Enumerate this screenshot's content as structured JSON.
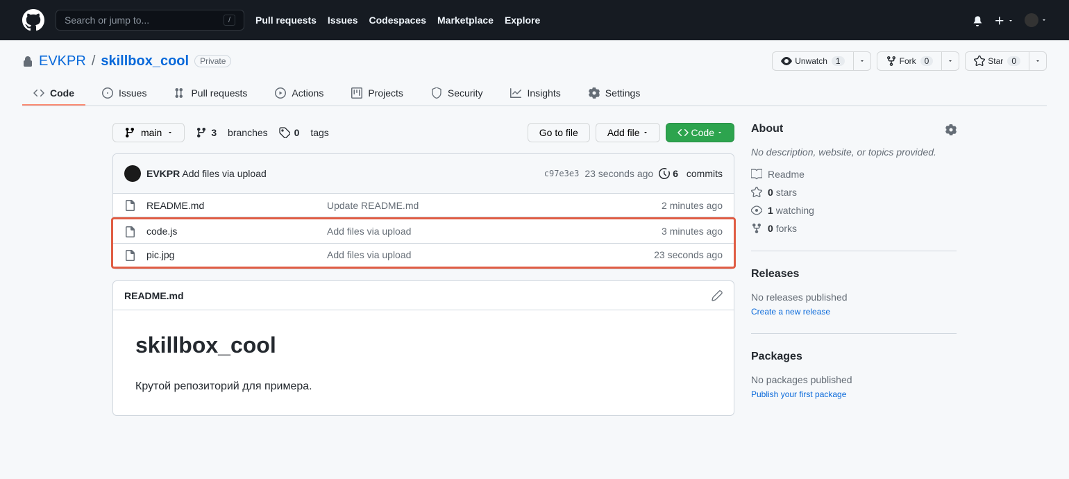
{
  "header": {
    "search_placeholder": "Search or jump to...",
    "nav": [
      "Pull requests",
      "Issues",
      "Codespaces",
      "Marketplace",
      "Explore"
    ]
  },
  "repo": {
    "owner": "EVKPR",
    "name": "skillbox_cool",
    "visibility": "Private",
    "watch": {
      "label": "Unwatch",
      "count": "1"
    },
    "fork": {
      "label": "Fork",
      "count": "0"
    },
    "star": {
      "label": "Star",
      "count": "0"
    }
  },
  "tabs": {
    "code": "Code",
    "issues": "Issues",
    "pulls": "Pull requests",
    "actions": "Actions",
    "projects": "Projects",
    "security": "Security",
    "insights": "Insights",
    "settings": "Settings"
  },
  "filenav": {
    "branch": "main",
    "branches_count": "3",
    "branches_label": "branches",
    "tags_count": "0",
    "tags_label": "tags",
    "goto": "Go to file",
    "addfile": "Add file",
    "code": "Code"
  },
  "latest_commit": {
    "author": "EVKPR",
    "message": "Add files via upload",
    "sha": "c97e3e3",
    "time": "23 seconds ago",
    "commits_count": "6",
    "commits_label": "commits"
  },
  "files": [
    {
      "name": "README.md",
      "msg": "Update README.md",
      "time": "2 minutes ago"
    },
    {
      "name": "code.js",
      "msg": "Add files via upload",
      "time": "3 minutes ago"
    },
    {
      "name": "pic.jpg",
      "msg": "Add files via upload",
      "time": "23 seconds ago"
    }
  ],
  "readme": {
    "filename": "README.md",
    "title": "skillbox_cool",
    "body": "Крутой репозиторий для примера."
  },
  "about": {
    "title": "About",
    "desc": "No description, website, or topics provided.",
    "readme": "Readme",
    "stars_count": "0",
    "stars_label": "stars",
    "watching_count": "1",
    "watching_label": "watching",
    "forks_count": "0",
    "forks_label": "forks"
  },
  "releases": {
    "title": "Releases",
    "none": "No releases published",
    "link": "Create a new release"
  },
  "packages": {
    "title": "Packages",
    "none": "No packages published",
    "link": "Publish your first package"
  }
}
